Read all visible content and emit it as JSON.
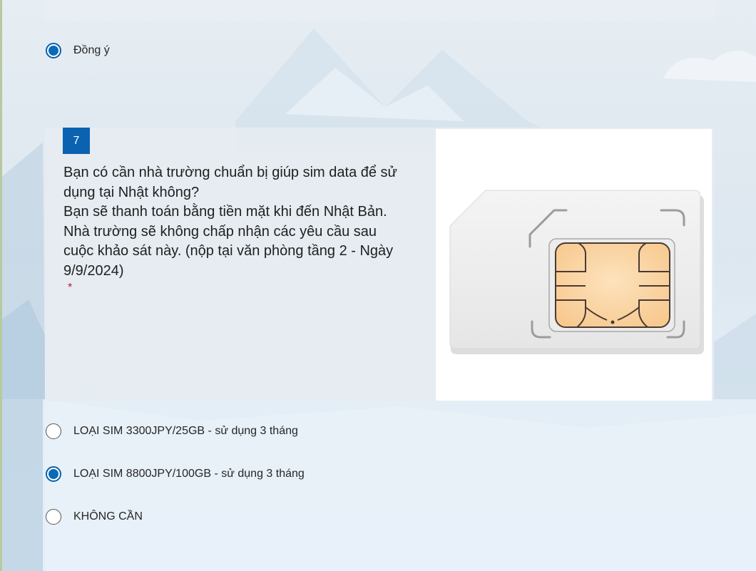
{
  "previous_question": {
    "agree_option": {
      "label": "Đồng ý",
      "selected": true
    }
  },
  "question": {
    "number": "7",
    "lines": [
      "Bạn có cần nhà trường chuẩn bị giúp sim data để sử",
      "dụng tại Nhật không?",
      "Bạn sẽ thanh toán bằng tiền mặt khi đến Nhật Bản.",
      "Nhà trường sẽ không chấp nhận các yêu cầu sau",
      "cuộc khảo sát này. (nộp tại văn phòng tầng 2 - Ngày",
      "9/9/2024)"
    ],
    "required_marker": "*",
    "image_icon": "sim-card-image",
    "options": [
      {
        "label": "LOẠI SIM 3300JPY/25GB - sử dụng 3 tháng",
        "selected": false
      },
      {
        "label": "LOẠI SIM 8800JPY/100GB - sử dụng 3 tháng",
        "selected": true
      },
      {
        "label": "KHÔNG CẦN",
        "selected": false
      }
    ]
  },
  "colors": {
    "accent": "#0b62b0",
    "required": "#a4262c",
    "card_background": "#e6ecf1"
  }
}
